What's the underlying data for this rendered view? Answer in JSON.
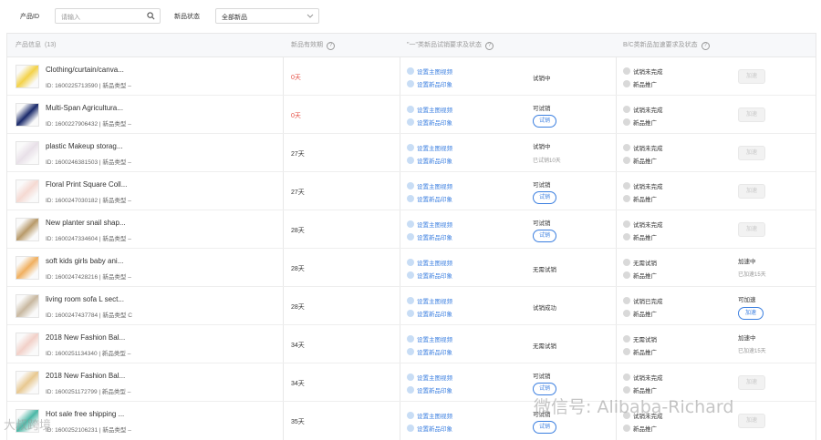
{
  "filters": {
    "product_id_label": "产品ID",
    "product_id_placeholder": "请输入",
    "status_label": "新品状态",
    "status_value": "全部新品"
  },
  "table": {
    "headers": {
      "product": "产品信息",
      "count": "(13)",
      "days": "新品有效期",
      "a_requirements": "\"一\"类新品试销要求及状态",
      "bc_requirements": "B/C类新品加速要求及状态"
    },
    "link1": "设置主图视频",
    "link2": "设置新品印象",
    "bc_promo": "新品推广",
    "accel_label": "加速",
    "rows": [
      {
        "name": "Clothing/curtain/canva...",
        "id": "ID: 1600225713590  |  新品类型 –",
        "days": "0天",
        "red": true,
        "a_status": "试销中",
        "a_sub": "",
        "try": false,
        "bc1": "试销未完成",
        "accel_status": "",
        "accel_sub": "",
        "accel_btn": "disabled"
      },
      {
        "name": "Multi-Span Agricultura...",
        "id": "ID: 1600227906432  |  新品类型 –",
        "days": "0天",
        "red": true,
        "a_status": "可试销",
        "a_sub": "",
        "try": true,
        "bc1": "试销未完成",
        "accel_status": "",
        "accel_sub": "",
        "accel_btn": "disabled"
      },
      {
        "name": "plastic Makeup storag...",
        "id": "ID: 1600246381503  |  新品类型 –",
        "days": "27天",
        "red": false,
        "a_status": "试销中",
        "a_sub": "已试销10天",
        "try": false,
        "bc1": "试销未完成",
        "accel_status": "",
        "accel_sub": "",
        "accel_btn": "disabled"
      },
      {
        "name": "Floral Print Square Coll...",
        "id": "ID: 1600247030182  |  新品类型 –",
        "days": "27天",
        "red": false,
        "a_status": "可试销",
        "a_sub": "",
        "try": true,
        "bc1": "试销未完成",
        "accel_status": "",
        "accel_sub": "",
        "accel_btn": "disabled"
      },
      {
        "name": "New planter snail shap...",
        "id": "ID: 1600247334604  |  新品类型 –",
        "days": "28天",
        "red": false,
        "a_status": "可试销",
        "a_sub": "",
        "try": true,
        "bc1": "试销未完成",
        "accel_status": "",
        "accel_sub": "",
        "accel_btn": "disabled"
      },
      {
        "name": "soft kids girls baby ani...",
        "id": "ID: 1600247428216  |  新品类型 –",
        "days": "28天",
        "red": false,
        "a_status": "无需试销",
        "a_sub": "",
        "try": false,
        "bc1": "无需试销",
        "accel_status": "加速中",
        "accel_sub": "已加速15天",
        "accel_btn": "none"
      },
      {
        "name": "living room sofa L sect...",
        "id": "ID: 1600247437784  |  新品类型 C",
        "days": "28天",
        "red": false,
        "a_status": "试销成功",
        "a_sub": "",
        "try": false,
        "bc1": "试销已完成",
        "accel_status": "可加速",
        "accel_sub": "",
        "accel_btn": "active"
      },
      {
        "name": "2018 New Fashion Bal...",
        "id": "ID: 1600251134340  |  新品类型 –",
        "days": "34天",
        "red": false,
        "a_status": "无需试销",
        "a_sub": "",
        "try": false,
        "bc1": "无需试销",
        "accel_status": "加速中",
        "accel_sub": "已加速15天",
        "accel_btn": "none"
      },
      {
        "name": "2018 New Fashion Bal...",
        "id": "ID: 1600251172799  |  新品类型 –",
        "days": "34天",
        "red": false,
        "a_status": "可试销",
        "a_sub": "",
        "try": true,
        "bc1": "试销未完成",
        "accel_status": "",
        "accel_sub": "",
        "accel_btn": "disabled"
      },
      {
        "name": "Hot sale free shipping ...",
        "id": "ID: 1600252106231  |  新品类型 –",
        "days": "35天",
        "red": false,
        "a_status": "可试销",
        "a_sub": "",
        "try": true,
        "bc1": "试销未完成",
        "accel_status": "",
        "accel_sub": "",
        "accel_btn": "disabled"
      }
    ],
    "try_label": "试销"
  },
  "watermark": {
    "main": "微信号: Alibaba-Richard",
    "corner": "大叔跨境"
  },
  "colors": {
    "accent": "#3b7fe0",
    "danger": "#e54d42"
  }
}
